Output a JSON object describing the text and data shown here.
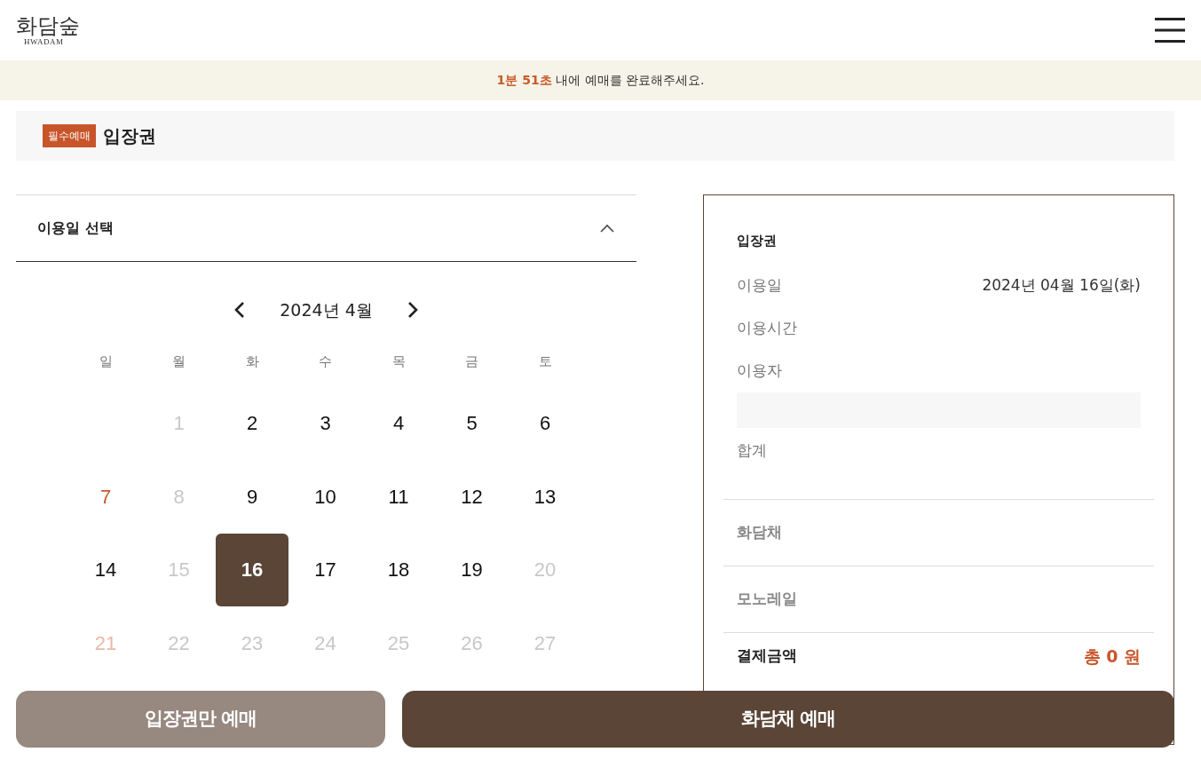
{
  "header": {
    "logo": "화담숲",
    "logo_sub": "HWADAM"
  },
  "timer_banner": {
    "time": "1분 51초",
    "message": "내에 예매를 완료해주세요."
  },
  "section": {
    "badge": "필수예매",
    "title": "입장권"
  },
  "date_picker": {
    "title": "이용일 선택",
    "expanded": true,
    "month": "2024년 4월",
    "weekdays": [
      "일",
      "월",
      "화",
      "수",
      "목",
      "금",
      "토"
    ],
    "days": [
      {
        "label": "1",
        "kind": "closed",
        "selected": false
      },
      {
        "label": "2",
        "kind": "open",
        "selected": false
      },
      {
        "label": "3",
        "kind": "open",
        "selected": false
      },
      {
        "label": "4",
        "kind": "open",
        "selected": false
      },
      {
        "label": "5",
        "kind": "open",
        "selected": false
      },
      {
        "label": "6",
        "kind": "open",
        "selected": false
      },
      {
        "label": "7",
        "kind": "holiday",
        "selected": false
      },
      {
        "label": "8",
        "kind": "closed",
        "selected": false
      },
      {
        "label": "9",
        "kind": "open",
        "selected": false
      },
      {
        "label": "10",
        "kind": "open",
        "selected": false
      },
      {
        "label": "11",
        "kind": "open",
        "selected": false
      },
      {
        "label": "12",
        "kind": "open",
        "selected": false
      },
      {
        "label": "13",
        "kind": "open",
        "selected": false
      },
      {
        "label": "14",
        "kind": "open",
        "selected": false
      },
      {
        "label": "15",
        "kind": "closed",
        "selected": false
      },
      {
        "label": "16",
        "kind": "open",
        "selected": true
      },
      {
        "label": "17",
        "kind": "open",
        "selected": false
      },
      {
        "label": "18",
        "kind": "open",
        "selected": false
      },
      {
        "label": "19",
        "kind": "open",
        "selected": false
      },
      {
        "label": "20",
        "kind": "closed",
        "selected": false
      },
      {
        "label": "21",
        "kind": "holiday-closed",
        "selected": false
      },
      {
        "label": "22",
        "kind": "closed",
        "selected": false
      },
      {
        "label": "23",
        "kind": "closed",
        "selected": false
      },
      {
        "label": "24",
        "kind": "closed",
        "selected": false
      },
      {
        "label": "25",
        "kind": "closed",
        "selected": false
      },
      {
        "label": "26",
        "kind": "closed",
        "selected": false
      },
      {
        "label": "27",
        "kind": "closed",
        "selected": false
      }
    ]
  },
  "summary": {
    "title": "입장권",
    "rows": [
      {
        "label": "이용일",
        "value": "2024년 04월 16일(화)"
      },
      {
        "label": "이용시간"
      },
      {
        "label": "이용자"
      }
    ],
    "total_label": "합계",
    "options": [
      "화담채",
      "모노레일"
    ],
    "payment_label": "결제금액",
    "payment_value": "총 0 원"
  },
  "buttons": [
    {
      "label": "입장권만 예매",
      "kind": "secondary"
    },
    {
      "label": "화담채 예매",
      "kind": "primary"
    }
  ]
}
